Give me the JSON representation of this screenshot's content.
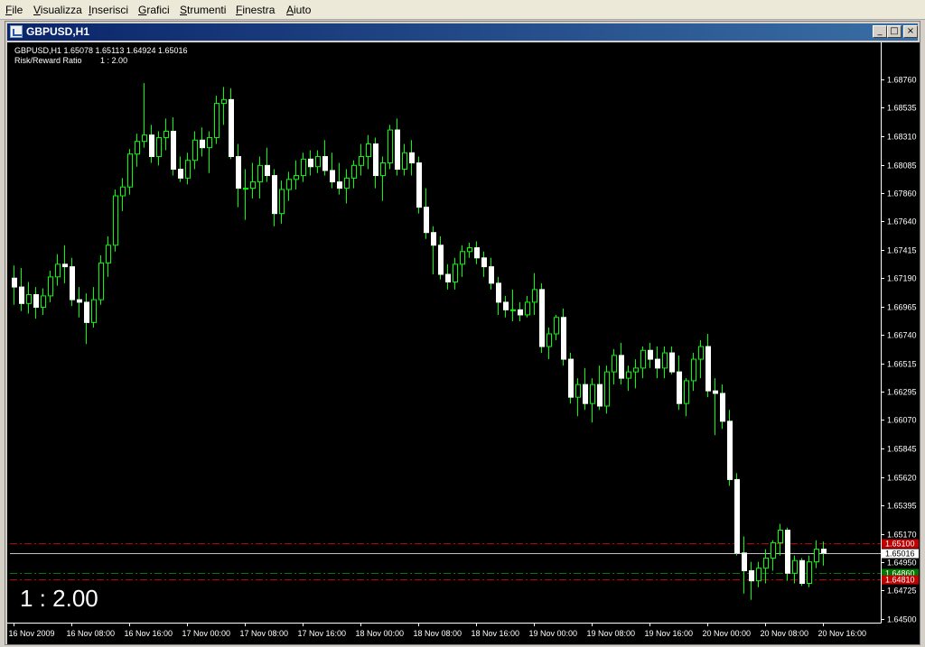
{
  "menu": [
    "File",
    "Visualizza",
    "Inserisci",
    "Grafici",
    "Strumenti",
    "Finestra",
    "Aiuto"
  ],
  "window": {
    "title": "GBPUSD,H1",
    "buttons": [
      "_",
      "□",
      "×"
    ]
  },
  "chart_data": {
    "type": "candlestick",
    "symbol": "GBPUSD,H1",
    "info_line": "GBPUSD,H1  1.65078 1.65113 1.64924 1.65016",
    "indicator_label": "Risk/Reward Ratio",
    "indicator_value": "1 : 2.00",
    "big_label": "1 : 2.00",
    "y_ticks": [
      "1.68760",
      "1.68535",
      "1.68310",
      "1.68085",
      "1.67860",
      "1.67640",
      "1.67415",
      "1.67190",
      "1.66965",
      "1.66740",
      "1.66515",
      "1.66295",
      "1.66070",
      "1.65845",
      "1.65620",
      "1.65395",
      "1.65170",
      "1.64950",
      "1.64725",
      "1.64500"
    ],
    "y_tick_values": [
      1.6876,
      1.68535,
      1.6831,
      1.68085,
      1.6786,
      1.6764,
      1.67415,
      1.6719,
      1.66965,
      1.6674,
      1.66515,
      1.66295,
      1.6607,
      1.65845,
      1.6562,
      1.65395,
      1.6517,
      1.6495,
      1.64725,
      1.645
    ],
    "ylim": [
      1.6447,
      1.6903
    ],
    "x_ticks": [
      "16 Nov 2009",
      "16 Nov 08:00",
      "16 Nov 16:00",
      "17 Nov 00:00",
      "17 Nov 08:00",
      "17 Nov 16:00",
      "18 Nov 00:00",
      "18 Nov 08:00",
      "18 Nov 16:00",
      "19 Nov 00:00",
      "19 Nov 08:00",
      "19 Nov 16:00",
      "20 Nov 00:00",
      "20 Nov 08:00",
      "20 Nov 16:00"
    ],
    "bars_per_x_tick": 8,
    "current_price": 1.65016,
    "current_price_label": "1.65016",
    "levels": [
      {
        "name": "stop-level-upper",
        "price": 1.651,
        "color": "#c00000",
        "label": "1.65100"
      },
      {
        "name": "entry-level",
        "price": 1.6486,
        "color": "#007a00",
        "label": "1.64860"
      },
      {
        "name": "stop-level-lower",
        "price": 1.6481,
        "color": "#c00000",
        "label": "1.64810"
      }
    ],
    "candles": [
      [
        1.6719,
        1.6729,
        1.6698,
        1.6712
      ],
      [
        1.6712,
        1.6727,
        1.6693,
        1.6699
      ],
      [
        1.6699,
        1.6716,
        1.6691,
        1.6706
      ],
      [
        1.6706,
        1.6712,
        1.6687,
        1.6696
      ],
      [
        1.6696,
        1.6711,
        1.669,
        1.6705
      ],
      [
        1.6705,
        1.6725,
        1.67,
        1.672
      ],
      [
        1.672,
        1.6738,
        1.6713,
        1.673
      ],
      [
        1.673,
        1.6745,
        1.6715,
        1.6728
      ],
      [
        1.6728,
        1.6735,
        1.6697,
        1.6702
      ],
      [
        1.6702,
        1.6712,
        1.6688,
        1.67
      ],
      [
        1.67,
        1.6707,
        1.6667,
        1.6684
      ],
      [
        1.6684,
        1.6712,
        1.668,
        1.6702
      ],
      [
        1.6702,
        1.6737,
        1.6698,
        1.6731
      ],
      [
        1.6731,
        1.6752,
        1.672,
        1.6745
      ],
      [
        1.6745,
        1.6789,
        1.674,
        1.6784
      ],
      [
        1.6784,
        1.6798,
        1.6772,
        1.6791
      ],
      [
        1.6791,
        1.6821,
        1.6785,
        1.6817
      ],
      [
        1.6817,
        1.6833,
        1.6807,
        1.6827
      ],
      [
        1.6827,
        1.6873,
        1.6822,
        1.6832
      ],
      [
        1.6832,
        1.684,
        1.681,
        1.6815
      ],
      [
        1.6815,
        1.6835,
        1.6808,
        1.683
      ],
      [
        1.683,
        1.6845,
        1.682,
        1.6835
      ],
      [
        1.6835,
        1.6846,
        1.68,
        1.6805
      ],
      [
        1.6805,
        1.6815,
        1.6795,
        1.6798
      ],
      [
        1.6798,
        1.6818,
        1.6793,
        1.6812
      ],
      [
        1.6812,
        1.6835,
        1.6805,
        1.6828
      ],
      [
        1.6828,
        1.6838,
        1.6815,
        1.6822
      ],
      [
        1.6822,
        1.6835,
        1.6802,
        1.683
      ],
      [
        1.683,
        1.6863,
        1.6825,
        1.6857
      ],
      [
        1.6857,
        1.687,
        1.684,
        1.686
      ],
      [
        1.686,
        1.6869,
        1.6813,
        1.6815
      ],
      [
        1.6815,
        1.6825,
        1.6775,
        1.679
      ],
      [
        1.679,
        1.6805,
        1.6765,
        1.679
      ],
      [
        1.679,
        1.681,
        1.6782,
        1.6795
      ],
      [
        1.6795,
        1.6815,
        1.6782,
        1.6808
      ],
      [
        1.6808,
        1.6822,
        1.6795,
        1.68
      ],
      [
        1.68,
        1.6805,
        1.676,
        1.677
      ],
      [
        1.677,
        1.6796,
        1.6762,
        1.6789
      ],
      [
        1.6789,
        1.6803,
        1.678,
        1.6797
      ],
      [
        1.6797,
        1.6812,
        1.6789,
        1.68
      ],
      [
        1.68,
        1.6818,
        1.6795,
        1.6813
      ],
      [
        1.6813,
        1.682,
        1.68,
        1.6807
      ],
      [
        1.6807,
        1.682,
        1.6802,
        1.6815
      ],
      [
        1.6815,
        1.6828,
        1.68,
        1.6804
      ],
      [
        1.6804,
        1.6818,
        1.679,
        1.6795
      ],
      [
        1.6795,
        1.681,
        1.6785,
        1.679
      ],
      [
        1.679,
        1.6805,
        1.6778,
        1.6798
      ],
      [
        1.6798,
        1.6812,
        1.679,
        1.6808
      ],
      [
        1.6808,
        1.6825,
        1.68,
        1.6815
      ],
      [
        1.6815,
        1.6832,
        1.6805,
        1.6825
      ],
      [
        1.6825,
        1.683,
        1.679,
        1.68
      ],
      [
        1.68,
        1.6815,
        1.678,
        1.681
      ],
      [
        1.681,
        1.684,
        1.6805,
        1.6836
      ],
      [
        1.6836,
        1.6845,
        1.68,
        1.6805
      ],
      [
        1.6805,
        1.6825,
        1.68,
        1.6818
      ],
      [
        1.6818,
        1.6828,
        1.68,
        1.681
      ],
      [
        1.681,
        1.6815,
        1.677,
        1.6775
      ],
      [
        1.6775,
        1.679,
        1.675,
        1.6755
      ],
      [
        1.6755,
        1.676,
        1.6722,
        1.6745
      ],
      [
        1.6745,
        1.6752,
        1.6718,
        1.6722
      ],
      [
        1.6722,
        1.673,
        1.671,
        1.6716
      ],
      [
        1.6716,
        1.6735,
        1.671,
        1.673
      ],
      [
        1.673,
        1.6745,
        1.672,
        1.674
      ],
      [
        1.674,
        1.6747,
        1.6735,
        1.6743
      ],
      [
        1.6743,
        1.6748,
        1.673,
        1.6735
      ],
      [
        1.6735,
        1.674,
        1.672,
        1.6728
      ],
      [
        1.6728,
        1.6735,
        1.671,
        1.6715
      ],
      [
        1.6715,
        1.672,
        1.669,
        1.67
      ],
      [
        1.67,
        1.6705,
        1.6688,
        1.6694
      ],
      [
        1.6694,
        1.671,
        1.6685,
        1.6694
      ],
      [
        1.6694,
        1.67,
        1.6685,
        1.669
      ],
      [
        1.669,
        1.6705,
        1.6688,
        1.67
      ],
      [
        1.67,
        1.6723,
        1.669,
        1.671
      ],
      [
        1.671,
        1.6715,
        1.666,
        1.6665
      ],
      [
        1.6665,
        1.668,
        1.6655,
        1.6675
      ],
      [
        1.6675,
        1.669,
        1.667,
        1.6688
      ],
      [
        1.6688,
        1.6695,
        1.665,
        1.6655
      ],
      [
        1.6655,
        1.666,
        1.662,
        1.6625
      ],
      [
        1.6625,
        1.664,
        1.661,
        1.6635
      ],
      [
        1.6635,
        1.6648,
        1.6615,
        1.662
      ],
      [
        1.662,
        1.664,
        1.6605,
        1.6635
      ],
      [
        1.6635,
        1.665,
        1.6615,
        1.6618
      ],
      [
        1.6618,
        1.665,
        1.6612,
        1.6645
      ],
      [
        1.6645,
        1.6663,
        1.6635,
        1.6658
      ],
      [
        1.6658,
        1.6668,
        1.6635,
        1.664
      ],
      [
        1.664,
        1.665,
        1.663,
        1.6645
      ],
      [
        1.6645,
        1.6655,
        1.6632,
        1.6648
      ],
      [
        1.6648,
        1.6665,
        1.664,
        1.6662
      ],
      [
        1.6662,
        1.6668,
        1.6648,
        1.6655
      ],
      [
        1.6655,
        1.6665,
        1.664,
        1.6648
      ],
      [
        1.6648,
        1.6665,
        1.664,
        1.666
      ],
      [
        1.666,
        1.6665,
        1.6643,
        1.6645
      ],
      [
        1.6645,
        1.6658,
        1.6615,
        1.662
      ],
      [
        1.662,
        1.664,
        1.661,
        1.6638
      ],
      [
        1.6638,
        1.666,
        1.663,
        1.6655
      ],
      [
        1.6655,
        1.667,
        1.664,
        1.6665
      ],
      [
        1.6665,
        1.6675,
        1.6625,
        1.663
      ],
      [
        1.663,
        1.664,
        1.6595,
        1.6628
      ],
      [
        1.6628,
        1.6635,
        1.66,
        1.6606
      ],
      [
        1.6606,
        1.6615,
        1.6555,
        1.656
      ],
      [
        1.656,
        1.6565,
        1.65,
        1.6502
      ],
      [
        1.6502,
        1.6515,
        1.647,
        1.6488
      ],
      [
        1.6488,
        1.6495,
        1.6465,
        1.648
      ],
      [
        1.648,
        1.6495,
        1.6475,
        1.649
      ],
      [
        1.649,
        1.6505,
        1.6478,
        1.6498
      ],
      [
        1.6498,
        1.6512,
        1.6488,
        1.651
      ],
      [
        1.651,
        1.6525,
        1.65,
        1.652
      ],
      [
        1.652,
        1.6522,
        1.648,
        1.6486
      ],
      [
        1.6486,
        1.65,
        1.6478,
        1.6496
      ],
      [
        1.6496,
        1.6498,
        1.6476,
        1.6478
      ],
      [
        1.6478,
        1.65,
        1.6475,
        1.6495
      ],
      [
        1.6495,
        1.6512,
        1.649,
        1.6505
      ],
      [
        1.6505,
        1.6511,
        1.6492,
        1.6502
      ]
    ]
  }
}
